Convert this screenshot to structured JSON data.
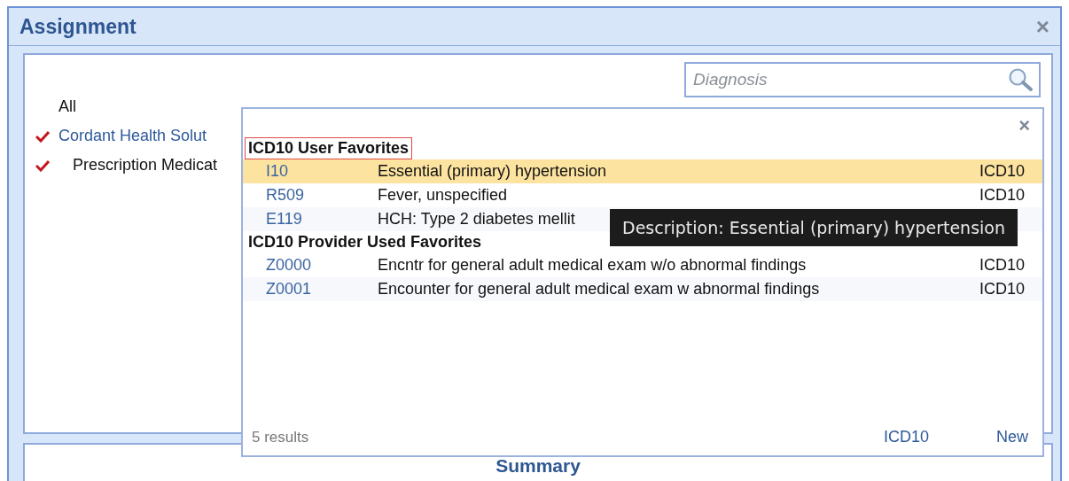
{
  "window": {
    "title": "Assignment",
    "close": "×"
  },
  "search": {
    "placeholder": "Diagnosis"
  },
  "tree": [
    {
      "label": "All",
      "checked": false
    },
    {
      "label": "Cordant Health Solut",
      "checked": true,
      "children": [
        {
          "label": "Prescription Medicat",
          "checked": true
        }
      ]
    }
  ],
  "popup": {
    "close": "×",
    "groups": [
      {
        "heading": "ICD10 User Favorites",
        "outlined": true,
        "rows": [
          {
            "code": "I10",
            "description": "Essential (primary) hypertension",
            "type": "ICD10",
            "selected": true
          },
          {
            "code": "R509",
            "description": "Fever, unspecified",
            "type": "ICD10",
            "selected": false
          },
          {
            "code": "E119",
            "description": "HCH: Type 2 diabetes mellit",
            "selected": false
          }
        ]
      },
      {
        "heading": "ICD10 Provider Used Favorites",
        "outlined": false,
        "rows": [
          {
            "code": "Z0000",
            "description": "Encntr for general adult medical exam w/o abnormal findings",
            "type": "ICD10",
            "selected": false
          },
          {
            "code": "Z0001",
            "description": "Encounter for general adult medical exam w abnormal findings",
            "type": "ICD10",
            "selected": false
          }
        ]
      }
    ],
    "footer": {
      "count": "5 results",
      "filter": "ICD10",
      "new": "New"
    }
  },
  "tooltip": "Description: Essential (primary) hypertension",
  "summary": {
    "title": "Summary"
  }
}
